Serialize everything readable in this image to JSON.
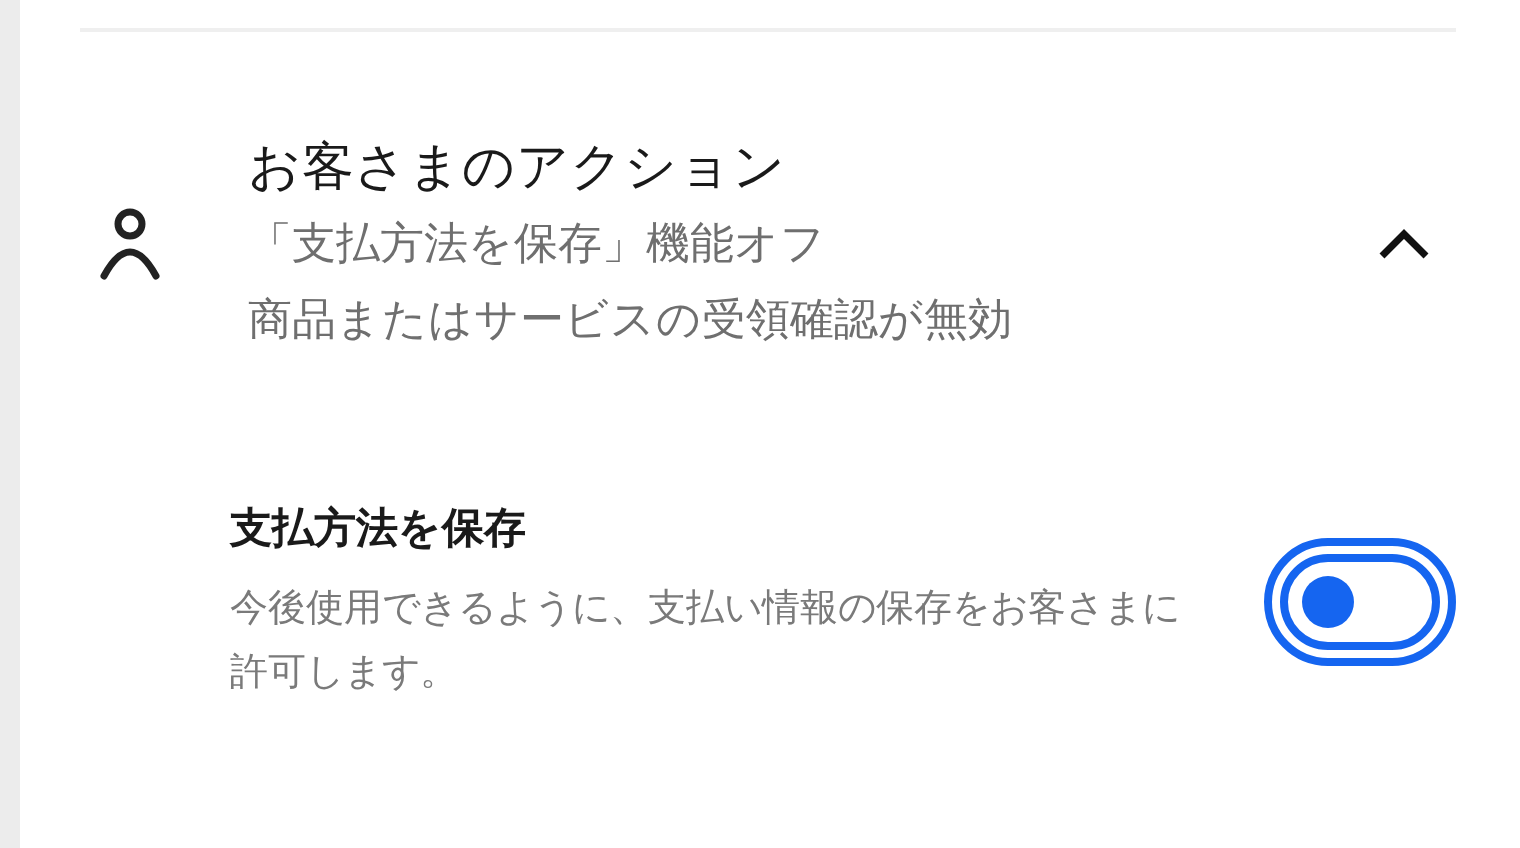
{
  "section": {
    "title": "お客さまのアクション",
    "summary": [
      "「支払方法を保存」機能オフ",
      "商品またはサービスの受領確認が無効"
    ],
    "expanded": true
  },
  "setting": {
    "title": "支払方法を保存",
    "description": "今後使用できるように、支払い情報の保存をお客さまに許可します。",
    "on": false,
    "focused": true
  }
}
